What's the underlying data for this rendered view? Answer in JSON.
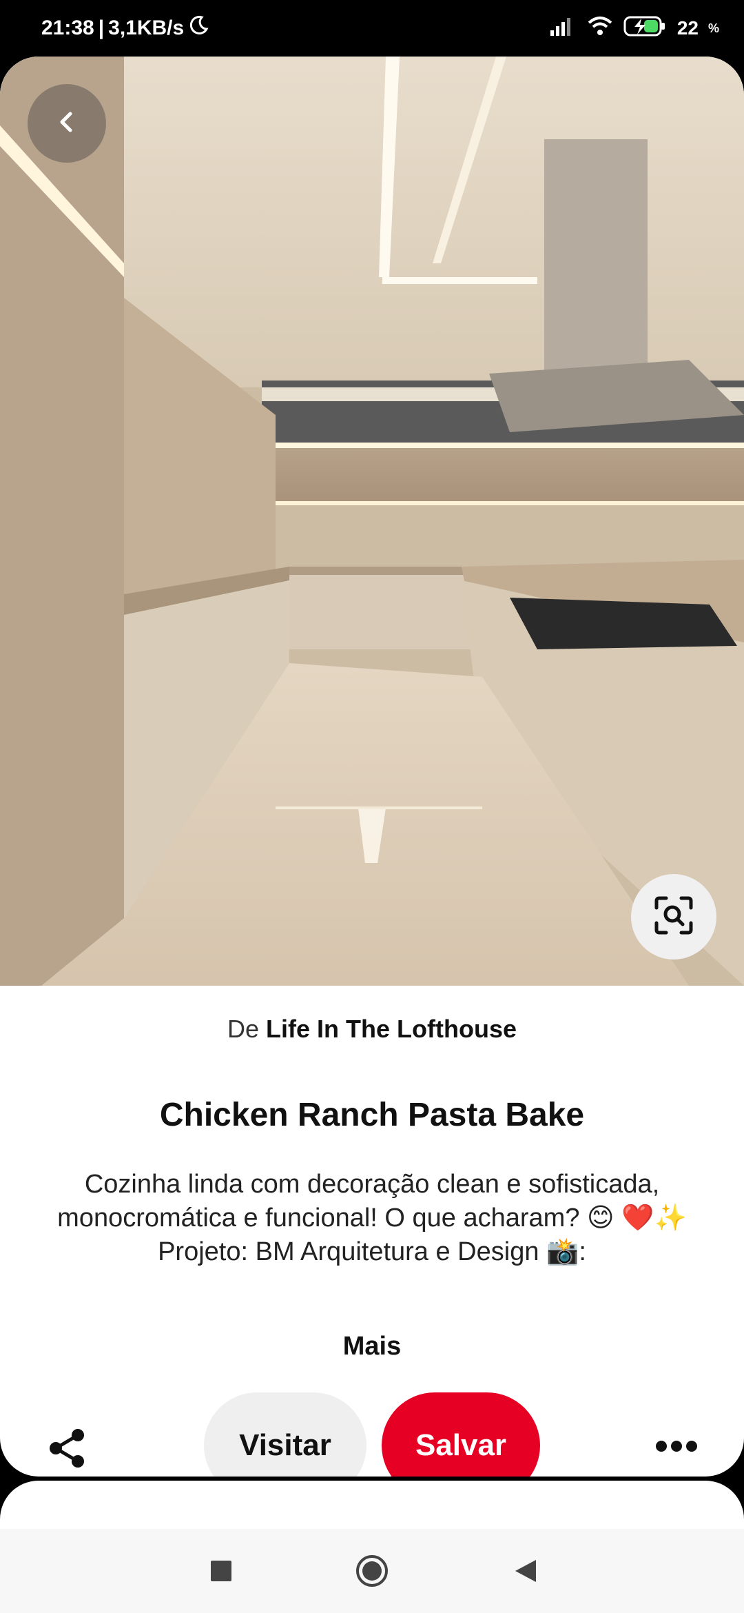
{
  "status_bar": {
    "time": "21:38",
    "network_speed": "3,1KB/s",
    "battery_percent": "22",
    "icons": [
      "moon-icon",
      "signal-icon",
      "wifi-icon",
      "battery-charging-icon"
    ]
  },
  "pin": {
    "image_description_icon": "kitchen-photo",
    "source_prefix": "De",
    "source_name": "Life In The Lofthouse",
    "title": "Chicken Ranch Pasta Bake",
    "description": "Cozinha linda com decoração clean e sofisticada, monocromática e funcional! O que acharam? 😊 ❤️✨  Projeto: BM Arquitetura e Design  📸:",
    "more_label": "Mais"
  },
  "actions": {
    "visit_label": "Visitar",
    "save_label": "Salvar"
  },
  "colors": {
    "save_red": "#e60023",
    "visit_gray": "#efefef"
  },
  "navigation": {
    "icons": [
      "recents-square-icon",
      "home-circle-icon",
      "back-triangle-icon"
    ]
  }
}
